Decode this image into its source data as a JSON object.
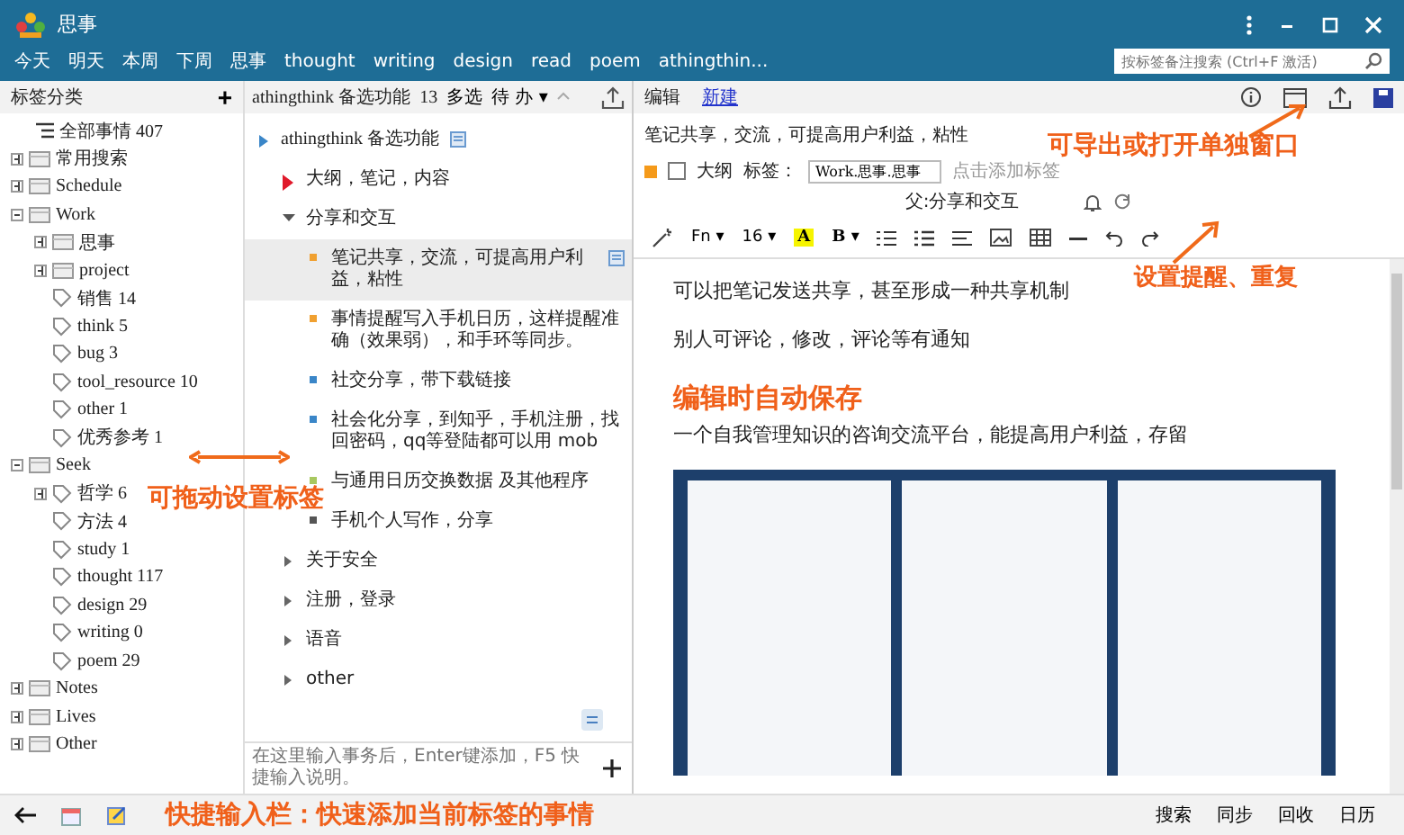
{
  "window": {
    "title": "思事"
  },
  "nav": [
    "今天",
    "明天",
    "本周",
    "下周",
    "思事",
    "thought",
    "writing",
    "design",
    "read",
    "poem",
    "athingthin..."
  ],
  "search": {
    "placeholder": "按标签备注搜索 (Ctrl+F 激活)"
  },
  "sidebar": {
    "title": "标签分类",
    "add": "+",
    "items": [
      {
        "kind": "all",
        "label": "全部事情 407"
      },
      {
        "kind": "folder",
        "label": "常用搜索",
        "expanded": false
      },
      {
        "kind": "folder",
        "label": "Schedule",
        "expanded": false
      },
      {
        "kind": "folder",
        "label": "Work",
        "expanded": true,
        "children": [
          {
            "kind": "folder",
            "label": "思事",
            "expanded": false
          },
          {
            "kind": "folder",
            "label": "project",
            "expanded": false
          },
          {
            "kind": "tag",
            "label": "销售 14"
          },
          {
            "kind": "tag",
            "label": "think 5"
          },
          {
            "kind": "tag",
            "label": "bug 3"
          },
          {
            "kind": "tag",
            "label": "tool_resource 10"
          },
          {
            "kind": "tag",
            "label": "other 1"
          },
          {
            "kind": "tag",
            "label": "优秀参考 1"
          }
        ]
      },
      {
        "kind": "folder",
        "label": "Seek",
        "expanded": true,
        "children": [
          {
            "kind": "tagfolder",
            "label": "哲学 6",
            "expanded": false
          },
          {
            "kind": "tag",
            "label": "方法 4"
          },
          {
            "kind": "tag",
            "label": "study 1"
          },
          {
            "kind": "tag",
            "label": "thought 117"
          },
          {
            "kind": "tag",
            "label": "design 29"
          },
          {
            "kind": "tag",
            "label": "writing 0"
          },
          {
            "kind": "tag",
            "label": "poem 29"
          }
        ]
      },
      {
        "kind": "folder",
        "label": "Notes",
        "expanded": false
      },
      {
        "kind": "folder",
        "label": "Lives",
        "expanded": false
      },
      {
        "kind": "folder",
        "label": "Other",
        "expanded": false
      }
    ]
  },
  "list": {
    "title": "athingthink 备选功能",
    "count": "13",
    "multi": "多选",
    "filter": "待 办 ▾",
    "quick_input": {
      "placeholder": "在这里输入事务后，Enter键添加，F5 快捷输入说明。"
    },
    "items": [
      {
        "label": "athingthink 备选功能",
        "expanded": true,
        "note": true,
        "children": [
          {
            "label": "大纲，笔记，内容",
            "expanded": false,
            "color": "#e0192b"
          },
          {
            "label": "分享和交互",
            "expanded": true,
            "children": [
              {
                "label": "笔记共享，交流，可提高用户利益，粘性",
                "color": "#f0a030",
                "selected": true,
                "note": true
              },
              {
                "label": "事情提醒写入手机日历，这样提醒准确（效果弱），和手环等同步。",
                "color": "#f0a030",
                "selected": false
              },
              {
                "label": "社交分享，带下载链接",
                "color": "#3a86c8",
                "selected": false
              },
              {
                "label": "社会化分享，到知乎，手机注册，找回密码，qq等登陆都可以用 mob",
                "color": "#3a86c8",
                "selected": false
              },
              {
                "label": "与通用日历交换数据 及其他程序",
                "color": "#a8c860",
                "selected": false
              },
              {
                "label": "手机个人写作，分享",
                "color": "#555555",
                "selected": false
              }
            ]
          },
          {
            "label": "关于安全",
            "expanded": false
          },
          {
            "label": "注册，登录",
            "expanded": false
          },
          {
            "label": "语音",
            "expanded": false
          },
          {
            "label": "other",
            "expanded": false
          }
        ]
      }
    ]
  },
  "editor": {
    "tabs": [
      {
        "label": "编辑",
        "selected": false
      },
      {
        "label": "新建",
        "selected": true
      }
    ],
    "title": "笔记共享，交流，可提高用户利益，粘性",
    "outline_checked": false,
    "outline_label": "大纲",
    "tags_label": "标签：",
    "tags_value": "Work.思事.思事",
    "add_tag": "点击添加标签",
    "parent": "父:分享和交互",
    "toolbar": [
      "Fn ▾",
      "16 ▾",
      "A",
      "B ▾"
    ],
    "body": [
      {
        "kind": "text",
        "text": "可以把笔记发送共享，甚至形成一种共享机制"
      },
      {
        "kind": "text",
        "text": "别人可评论，修改，评论等有通知"
      },
      {
        "kind": "spacer"
      },
      {
        "kind": "text",
        "text": "一个自我管理知识的咨询交流平台，能提高用户利益，存留"
      },
      {
        "kind": "image"
      }
    ]
  },
  "status_bar": [
    "搜索",
    "同步",
    "回收",
    "日历"
  ],
  "annotations": [
    {
      "text": "可导出或打开单独窗口",
      "kind": "export"
    },
    {
      "text": "设置提醒、重复",
      "kind": "remind"
    },
    {
      "text": "编辑时自动保存",
      "kind": "autosave"
    },
    {
      "text": "可拖动设置标签",
      "kind": "drag"
    },
    {
      "text": "快捷输入栏：快速添加当前标签的事情",
      "kind": "quick"
    }
  ]
}
